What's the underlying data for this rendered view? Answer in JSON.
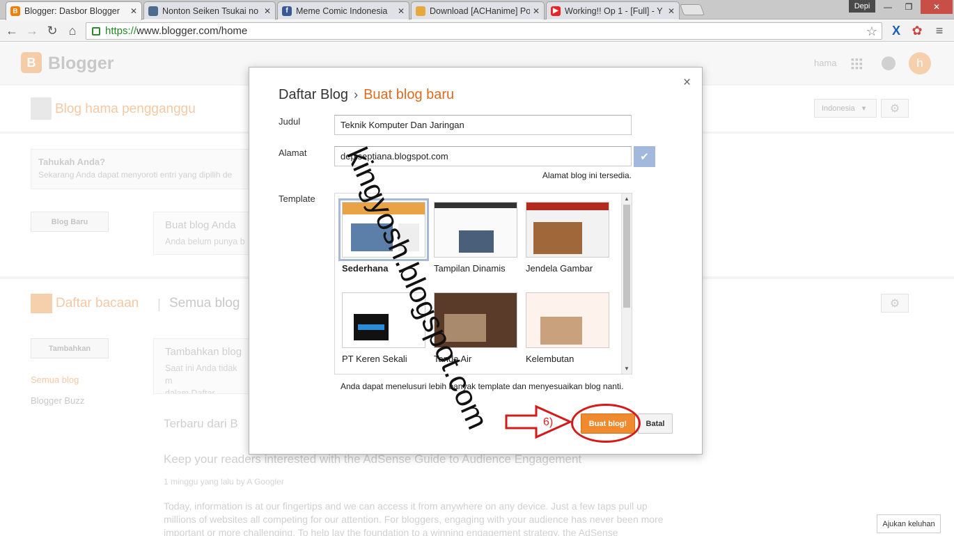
{
  "browser": {
    "tabs": [
      {
        "title": "Blogger: Dasbor Blogger",
        "icon": "blogger-icon",
        "active": true
      },
      {
        "title": "Nonton Seiken Tsukai no",
        "icon": "tv-icon"
      },
      {
        "title": "Meme Comic Indonesia",
        "icon": "facebook-icon"
      },
      {
        "title": "Download [ACHanime] Po",
        "icon": "folder-icon"
      },
      {
        "title": "Working!! Op 1 - [Full] - Y",
        "icon": "youtube-icon"
      }
    ],
    "user": "Depi",
    "url_secure": "https://",
    "url_rest": "www.blogger.com/home"
  },
  "page": {
    "brand": "Blogger",
    "header_user": "hama",
    "avatar_letter": "h",
    "blog_name": "Blog hama pengganggu",
    "language": "Indonesia",
    "tip_title": "Tahukah Anda?",
    "tip_body": "Sekarang Anda dapat menyoroti entri yang dipilih de",
    "new_blog_button": "Blog Baru",
    "create_blog_title": "Buat blog Anda",
    "create_blog_body": "Anda belum punya b",
    "reading_list": "Daftar bacaan",
    "separator": "|",
    "all_blogs": "Semua blog",
    "add_button": "Tambahkan",
    "add_blogs_title": "Tambahkan blog",
    "add_blogs_body": "Saat ini Anda tidak m\ndalam Daftar Bacaan",
    "nav_all": "Semua blog",
    "nav_buzz": "Blogger Buzz",
    "latest_from": "Terbaru dari B",
    "post_title": "Keep your readers interested with the AdSense Guide to Audience Engagement",
    "post_meta": "1 minggu yang lalu by A Googler",
    "post_body": "Today, information is at our fingertips and we can access it from anywhere on any device. Just a few taps pull up millions of websites all competing for our attention. For bloggers, engaging with your audience has never been more important or more challenging. To help lay the foundation to a winning engagement strategy, the AdSense",
    "report_button": "Ajukan keluhan"
  },
  "dialog": {
    "crumb_root": "Daftar Blog",
    "crumb_sep": "›",
    "crumb_current": "Buat blog baru",
    "title_label": "Judul",
    "title_value": "Teknik Komputer Dan Jaringan",
    "address_label": "Alamat",
    "address_value": "depiseptiana.blogspot.com",
    "available_text": "Alamat blog ini tersedia.",
    "template_label": "Template",
    "templates": [
      {
        "name": "Sederhana",
        "selected": true
      },
      {
        "name": "Tampilan Dinamis"
      },
      {
        "name": "Jendela Gambar"
      },
      {
        "name": "PT Keren Sekali"
      },
      {
        "name": "Tanda Air"
      },
      {
        "name": "Kelembutan"
      }
    ],
    "template_note": "Anda dapat menelusuri lebih banyak template dan menyesuaikan blog nanti.",
    "create_button": "Buat blog!",
    "cancel_button": "Batal",
    "close": "×"
  },
  "annotation": {
    "step": "6)",
    "watermark": "kingyosh.blogspot.com"
  },
  "colors": {
    "accent": "#dd6b20",
    "create_button": "#f08a2e",
    "annotation_red": "#d41a1a"
  }
}
